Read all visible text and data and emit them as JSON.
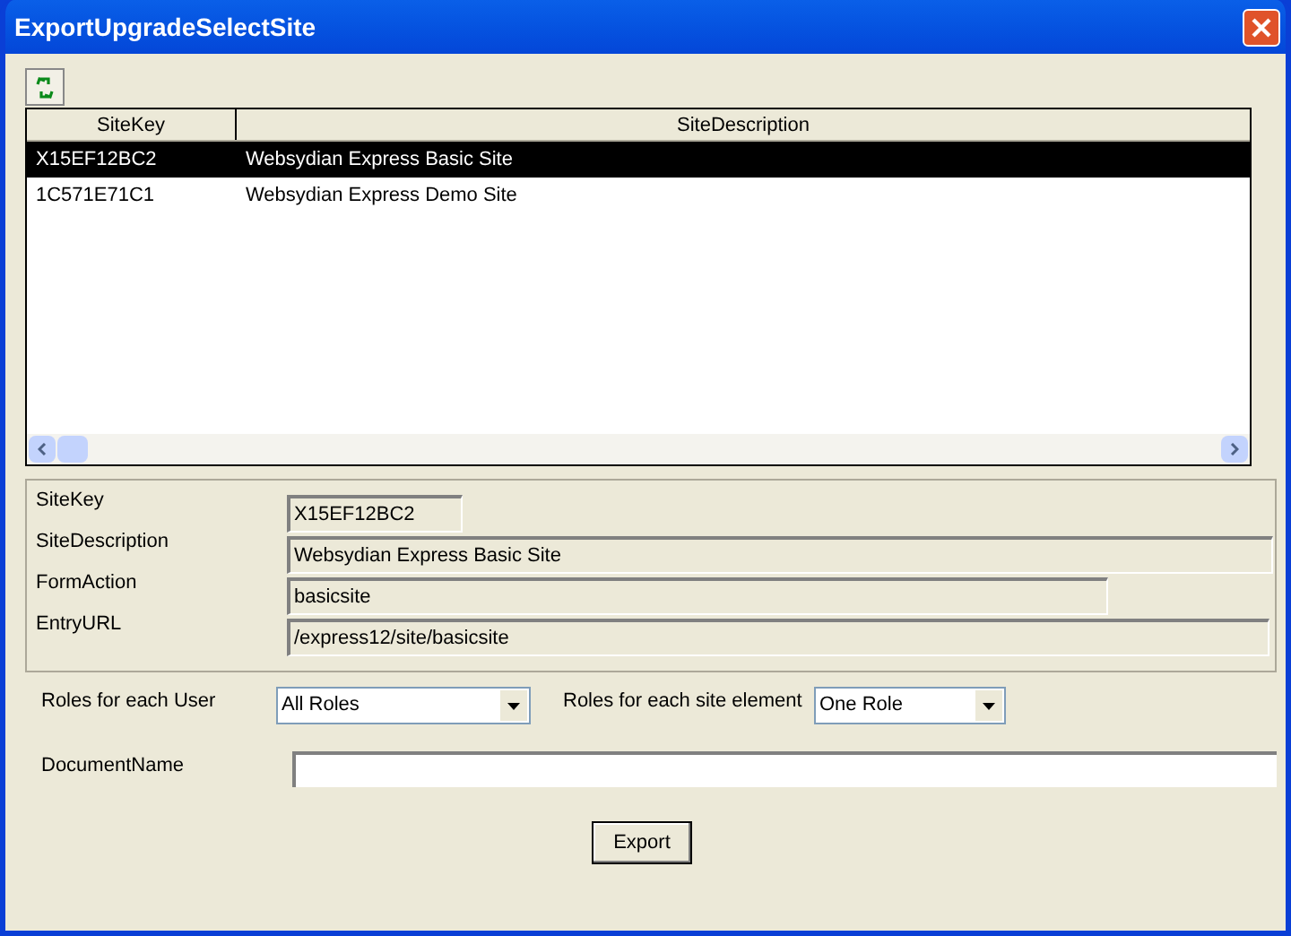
{
  "window": {
    "title": "ExportUpgradeSelectSite"
  },
  "table": {
    "columns": [
      "SiteKey",
      "SiteDescription"
    ],
    "rows": [
      {
        "cells": [
          "X15EF12BC2",
          "Websydian Express Basic Site"
        ],
        "selected": true
      },
      {
        "cells": [
          "1C571E71C1",
          "Websydian Express Demo Site"
        ],
        "selected": false
      }
    ]
  },
  "details": [
    {
      "label": "SiteKey",
      "value": "X15EF12BC2"
    },
    {
      "label": "SiteDescription",
      "value": "Websydian Express Basic Site"
    },
    {
      "label": "FormAction",
      "value": "basicsite"
    },
    {
      "label": "EntryURL",
      "value": "/express12/site/basicsite"
    }
  ],
  "roles": [
    {
      "label": "Roles for each User",
      "value": "All Roles"
    },
    {
      "label": "Roles for each site element",
      "value": "One Role"
    }
  ],
  "document_name": {
    "label": "DocumentName"
  },
  "export_button": "Export"
}
